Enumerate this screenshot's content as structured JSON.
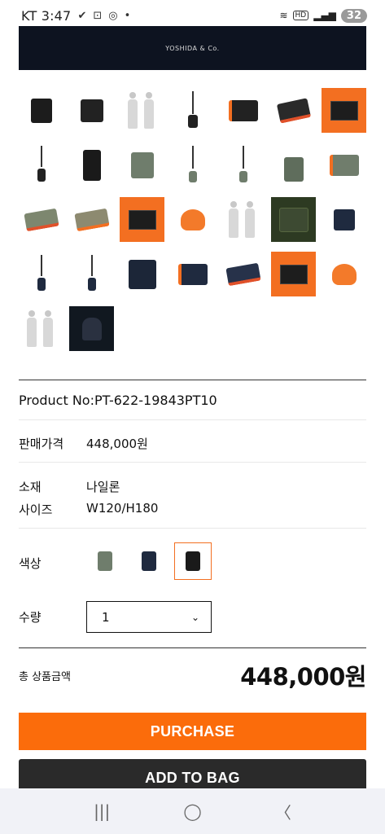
{
  "status_bar": {
    "carrier_time": "KT 3:47",
    "notif_icons": [
      "vpn-icon",
      "screenshot-icon",
      "instagram-icon",
      "dot-icon"
    ],
    "battery": "32",
    "hd_badge": "HD"
  },
  "banner": {
    "brand": "YOSHIDA & Co."
  },
  "thumbnails": [
    "black-pouch",
    "black-pouch-side",
    "model-pair",
    "strap-black",
    "black-open",
    "black-contents",
    "orange-label",
    "black-long-strap",
    "black-shoulder",
    "sage-pouch",
    "sage-strap",
    "sage-strap-2",
    "sage-neck",
    "sage-open",
    "sage-contents",
    "orange-contents",
    "orange-label-2",
    "orange-drawstring",
    "model-pair-2",
    "green-card",
    "navy-pouch",
    "navy-strap",
    "navy-strap-2",
    "navy-shoulder",
    "navy-open",
    "navy-contents",
    "orange-label-3",
    "orange-drawstring-2",
    "model-pair-3",
    "dark-card"
  ],
  "product": {
    "product_no": "Product No:PT-622-19843PT10",
    "price_label": "판매가격",
    "price_value": "448,000원",
    "material_label": "소재",
    "material_value": "나일론",
    "size_label": "사이즈",
    "size_value": "W120/H180",
    "color_label": "색상",
    "colors": [
      "sage",
      "navy",
      "black"
    ],
    "selected_color": "black",
    "qty_label": "수량",
    "qty_value": "1",
    "total_label": "총 상품금액",
    "total_value": "448,000원"
  },
  "buttons": {
    "purchase": "PURCHASE",
    "add_to_bag": "ADD TO BAG"
  },
  "accent": "#fb6c0b",
  "nav_icons": [
    "recents-icon",
    "home-icon",
    "back-icon"
  ]
}
